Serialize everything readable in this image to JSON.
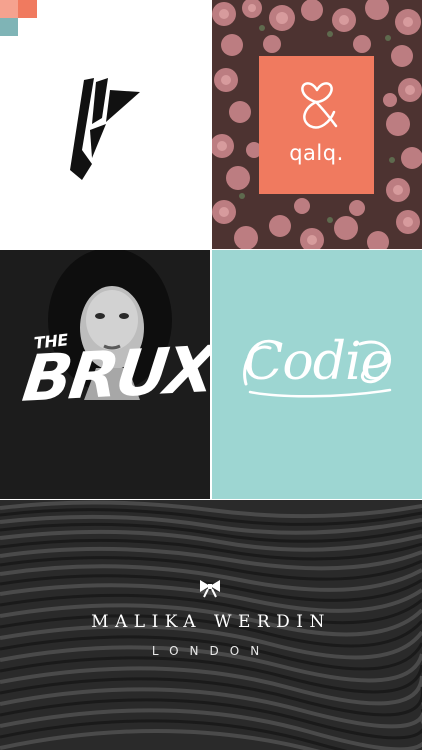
{
  "colors": {
    "accent_orange": "#f07a5f",
    "accent_pink": "#f5a28f",
    "accent_teal": "#7fb4b6",
    "mint": "#9dd6d2",
    "dark": "#1f1f1f",
    "white": "#ffffff"
  },
  "tiles": [
    {
      "icon": "angular-a-logo-icon"
    },
    {
      "icon": "ampersand-heart-icon",
      "text": "qalq."
    },
    {
      "text_small": "THE",
      "text_large": "BRUX"
    },
    {
      "text": "Codie"
    },
    {
      "icon": "bow-icon",
      "name": "MALIKA WERDIN",
      "city": "LONDON"
    }
  ]
}
